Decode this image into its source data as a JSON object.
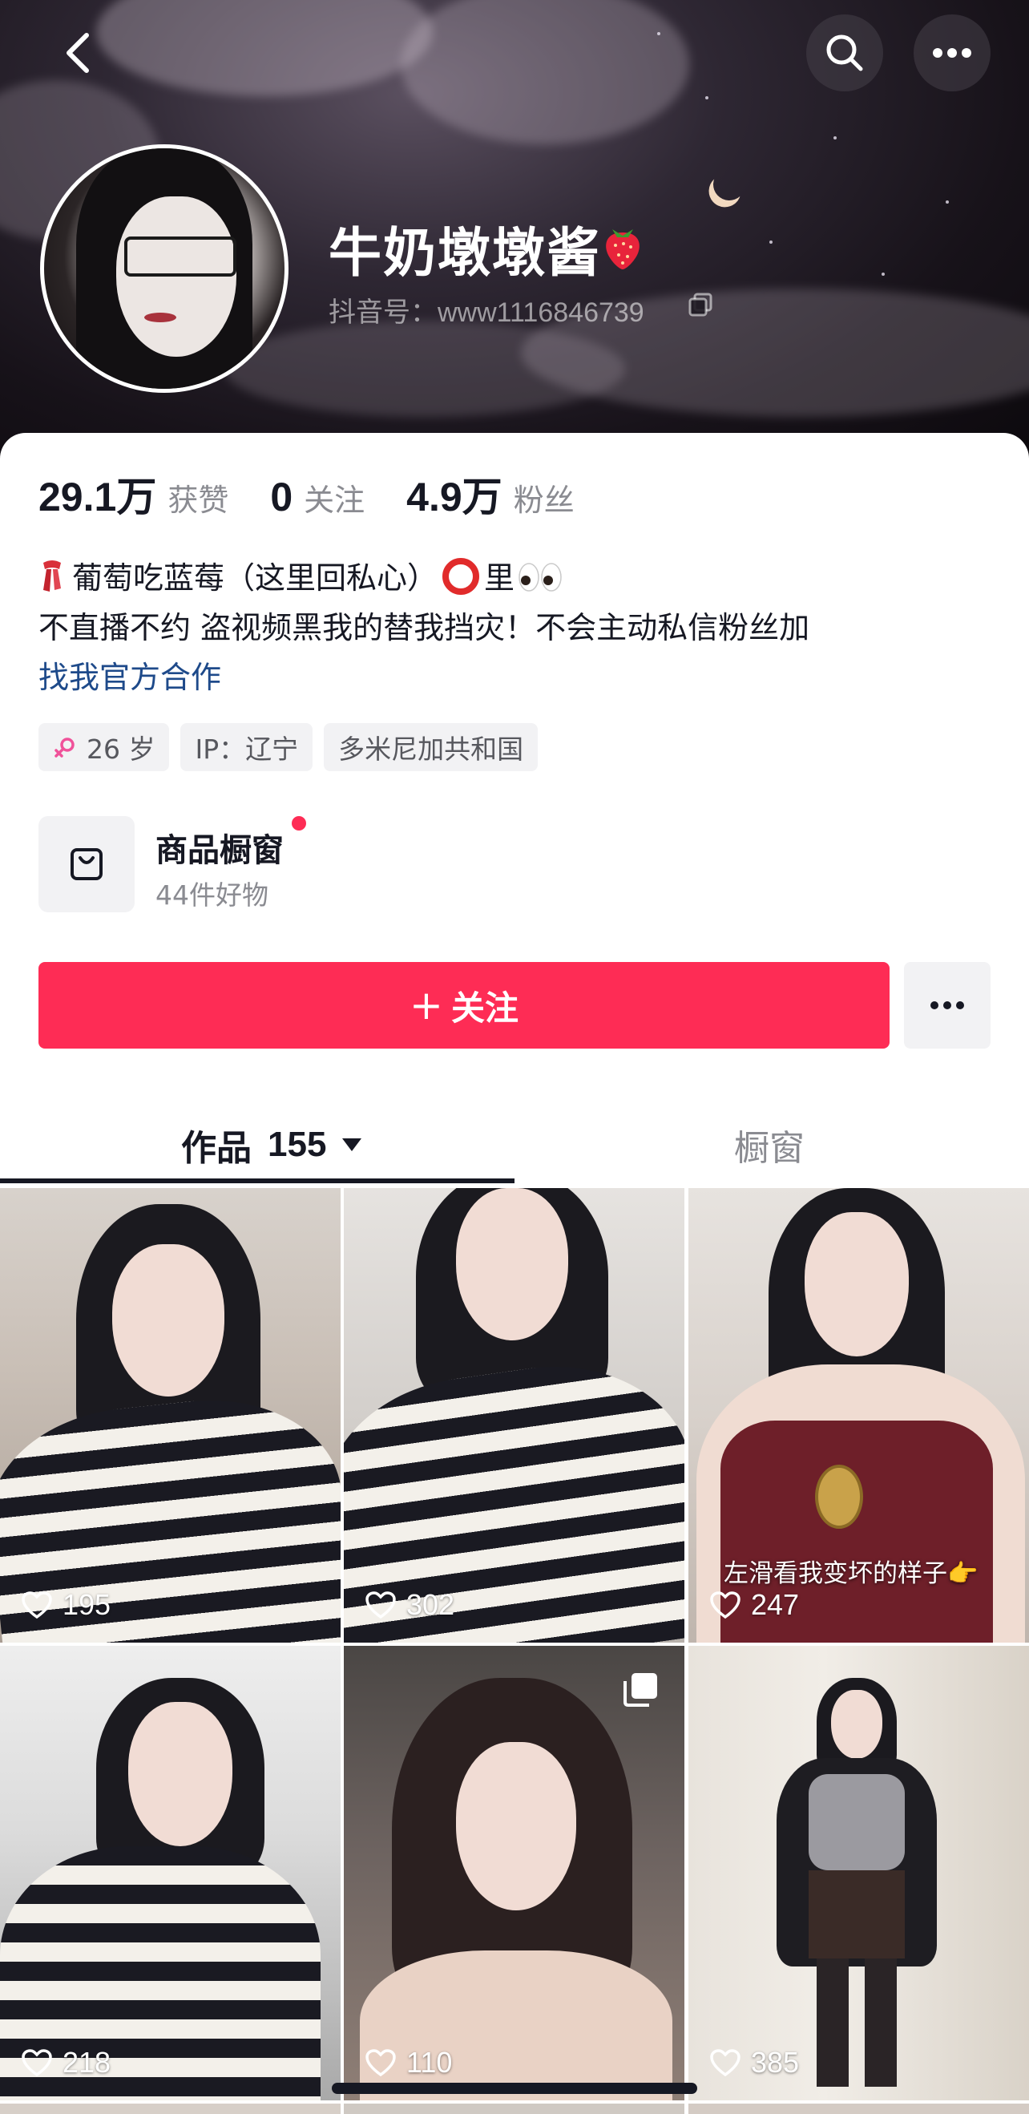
{
  "header": {
    "nickname": "牛奶墩墩酱",
    "douyin_id": "抖音号：www1116846739"
  },
  "stats": [
    {
      "value": "29.1万",
      "label": "获赞"
    },
    {
      "value": "0",
      "label": "关注"
    },
    {
      "value": "4.9万",
      "label": "粉丝"
    }
  ],
  "bio": {
    "line1": "葡萄吃蓝莓（这里回私心）",
    "line1_suffix": "里",
    "line2": "不直播不约 盗视频黑我的替我挡灾！不会主动私信粉丝加",
    "link": "找我官方合作"
  },
  "tags": {
    "age": "26 岁",
    "ip": "IP：辽宁",
    "country": "多米尼加共和国"
  },
  "shop": {
    "title": "商品橱窗",
    "subtitle": "44件好物"
  },
  "actions": {
    "follow_plus": "+",
    "follow_label": "关注"
  },
  "tabs": {
    "works_label": "作品",
    "works_count": "155",
    "shop_label": "橱窗"
  },
  "videos": [
    {
      "likes": "195"
    },
    {
      "likes": "302"
    },
    {
      "likes": "247",
      "caption": "左滑看我变坏的样子👉"
    },
    {
      "likes": "218"
    },
    {
      "likes": "110"
    },
    {
      "likes": "385"
    }
  ],
  "colors": {
    "accent": "#fe2c55",
    "text": "#161823",
    "muted": "#8a8b91",
    "link": "#1e4a8a"
  }
}
